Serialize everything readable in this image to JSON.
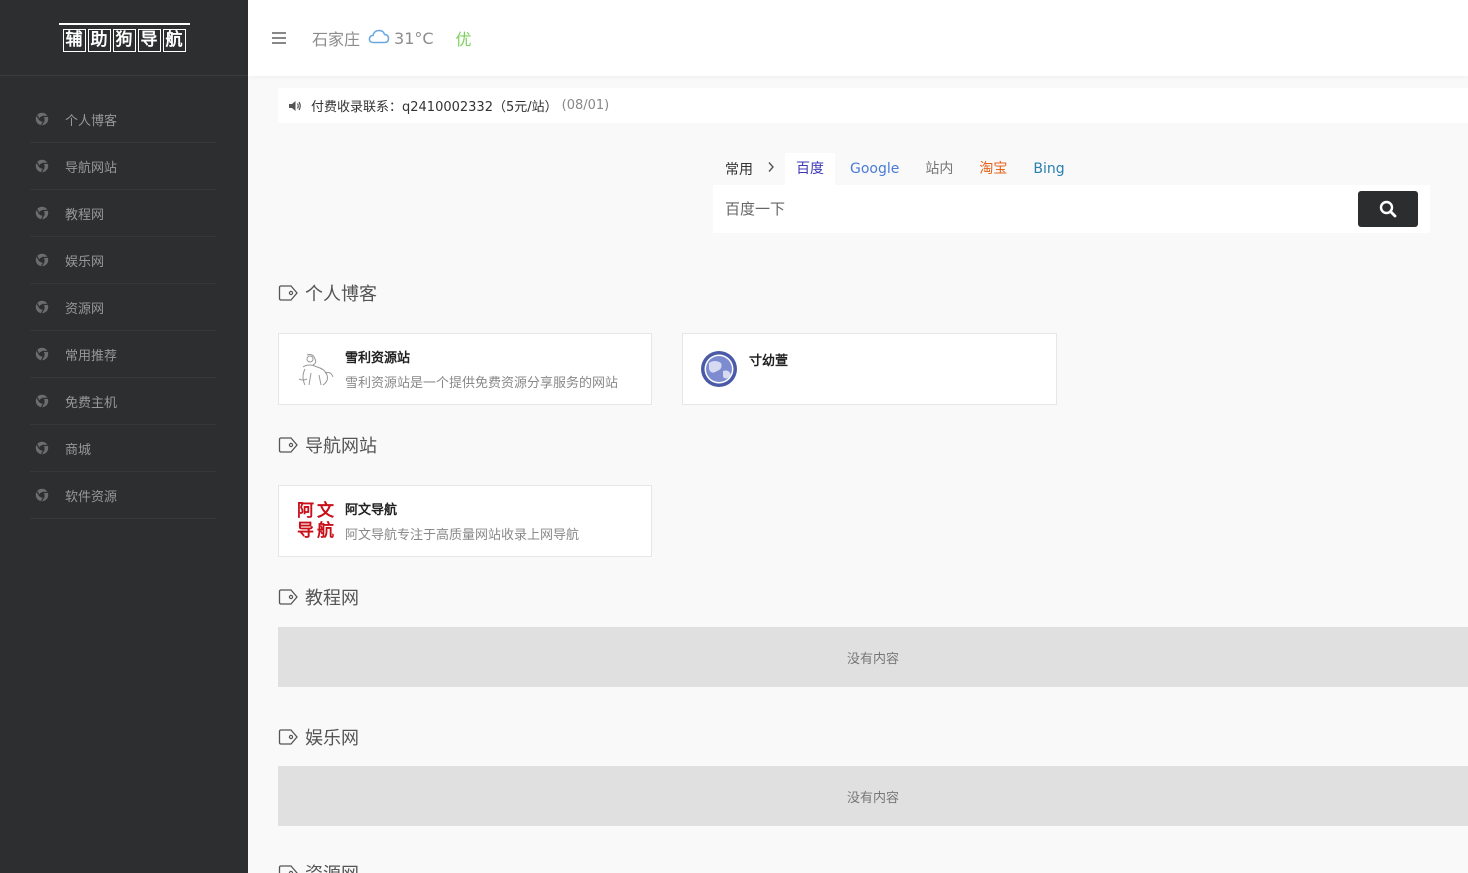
{
  "logo": {
    "chars": [
      "辅",
      "助",
      "狗",
      "导",
      "航"
    ]
  },
  "sidebar": {
    "items": [
      {
        "label": "个人博客"
      },
      {
        "label": "导航网站"
      },
      {
        "label": "教程网"
      },
      {
        "label": "娱乐网"
      },
      {
        "label": "资源网"
      },
      {
        "label": "常用推荐"
      },
      {
        "label": "免费主机"
      },
      {
        "label": "商城"
      },
      {
        "label": "软件资源"
      }
    ]
  },
  "header": {
    "city": "石家庄",
    "temperature": "31°C",
    "air_quality": "优"
  },
  "notice": {
    "text": "付费收录联系：q2410002332（5元/站）",
    "date": "(08/01)"
  },
  "search": {
    "group_label": "常用",
    "tabs": [
      {
        "label": "百度",
        "color": "#3d38b4"
      },
      {
        "label": "Google",
        "color": "#4a7bd8"
      },
      {
        "label": "站内",
        "color": "#777777"
      },
      {
        "label": "淘宝",
        "color": "#e8621a"
      },
      {
        "label": "Bing",
        "color": "#2a7fae"
      }
    ],
    "placeholder": "百度一下"
  },
  "sections": [
    {
      "title": "个人博客",
      "cards": [
        {
          "name": "雪利资源站",
          "desc": "雪利资源站是一个提供免费资源分享服务的网站"
        },
        {
          "name": "寸幼萱",
          "desc": ""
        }
      ]
    },
    {
      "title": "导航网站",
      "cards": [
        {
          "name": "阿文导航",
          "desc": "阿文导航专注于高质量网站收录上网导航",
          "logo_text": "阿文导航"
        }
      ]
    },
    {
      "title": "教程网",
      "empty_text": "没有内容"
    },
    {
      "title": "娱乐网",
      "empty_text": "没有内容"
    },
    {
      "title": "资源网"
    }
  ],
  "colors": {
    "sidebar_bg": "#2c2e2f",
    "accent_green": "#7ccf5b",
    "search_button": "#2b2d2e"
  }
}
